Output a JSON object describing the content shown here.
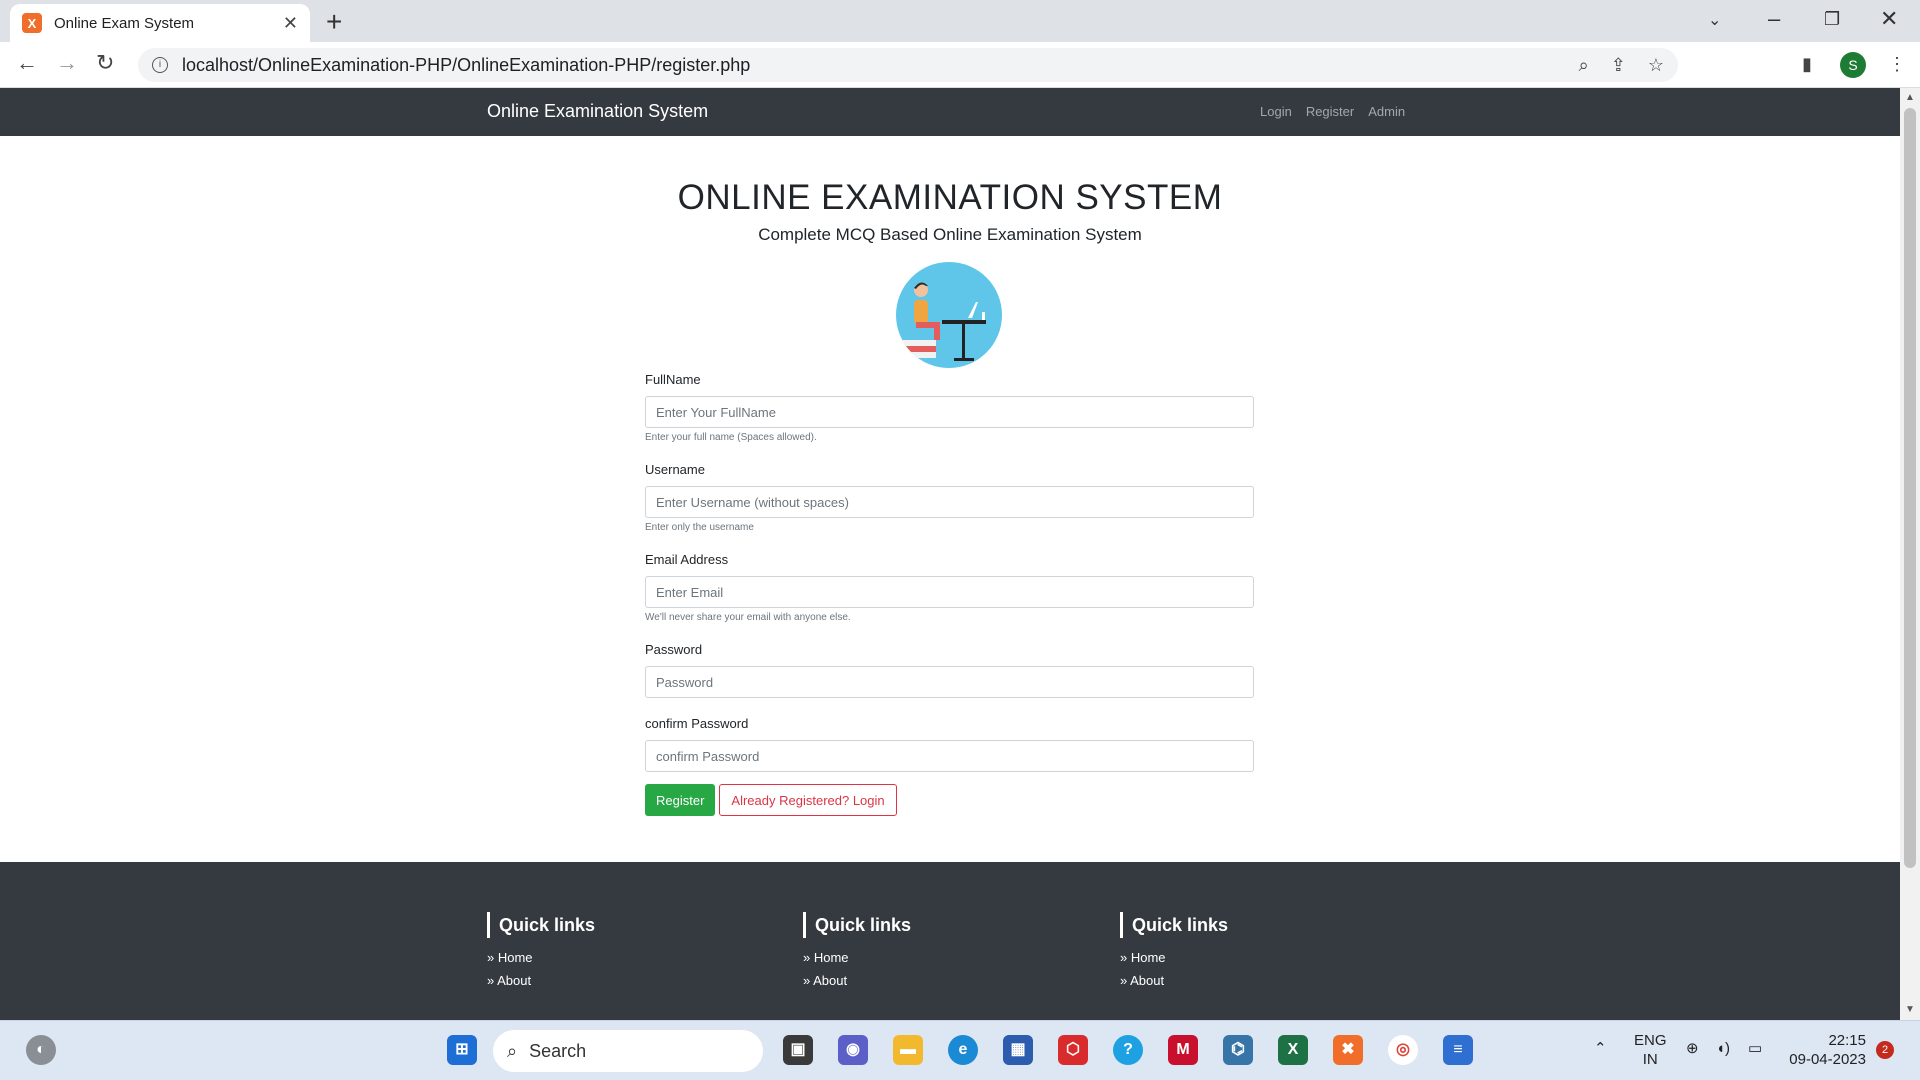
{
  "browser": {
    "tab_title": "Online Exam System",
    "favicon_letter": "X",
    "url": "localhost/OnlineExamination-PHP/OnlineExamination-PHP/register.php",
    "profile_initial": "S"
  },
  "navbar": {
    "brand": "Online Examination System",
    "links": [
      "Login",
      "Register",
      "Admin"
    ]
  },
  "hero": {
    "title": "ONLINE EXAMINATION SYSTEM",
    "subtitle": "Complete MCQ Based Online Examination System"
  },
  "form": {
    "fullname": {
      "label": "FullName",
      "placeholder": "Enter Your FullName",
      "help": "Enter your full name (Spaces allowed)."
    },
    "username": {
      "label": "Username",
      "placeholder": "Enter Username (without spaces)",
      "help": "Enter only the username"
    },
    "email": {
      "label": "Email Address",
      "placeholder": "Enter Email",
      "help": "We'll never share your email with anyone else."
    },
    "password": {
      "label": "Password",
      "placeholder": "Password"
    },
    "confirm": {
      "label": "confirm Password",
      "placeholder": "confirm Password"
    },
    "register_button": "Register",
    "login_button": "Already Registered? Login"
  },
  "footer": {
    "columns": [
      {
        "heading": "Quick links",
        "links": [
          "Home",
          "About"
        ]
      },
      {
        "heading": "Quick links",
        "links": [
          "Home",
          "About"
        ]
      },
      {
        "heading": "Quick links",
        "links": [
          "Home",
          "About"
        ]
      }
    ],
    "bullet": "»"
  },
  "taskbar": {
    "search_label": "Search",
    "lang_line1": "ENG",
    "lang_line2": "IN",
    "time": "22:15",
    "date": "09-04-2023",
    "notification_count": "2"
  },
  "colors": {
    "navbar_bg": "#343a40",
    "register_green": "#28a745",
    "login_red": "#dc3545"
  }
}
